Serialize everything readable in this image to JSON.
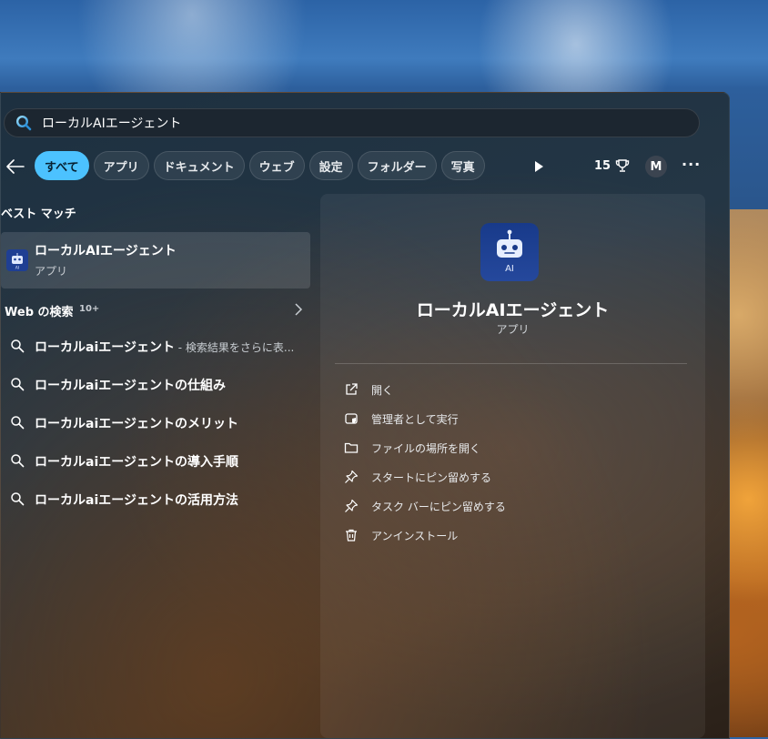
{
  "search": {
    "query": "ローカルAIエージェント"
  },
  "filters": [
    "すべて",
    "アプリ",
    "ドキュメント",
    "ウェブ",
    "設定",
    "フォルダー",
    "写真"
  ],
  "toolbar": {
    "points": "15",
    "avatar": "M",
    "more": "···"
  },
  "best_match": {
    "heading": "ベスト マッチ",
    "name": "ローカルAIエージェント",
    "type": "アプリ"
  },
  "web": {
    "heading": "Web の検索",
    "count": "10+",
    "suggestions": [
      {
        "text": "ローカルaiエージェント",
        "sub": " - 検索結果をさらに表..."
      },
      {
        "text": "ローカルaiエージェントの仕組み",
        "sub": ""
      },
      {
        "text": "ローカルaiエージェントのメリット",
        "sub": ""
      },
      {
        "text": "ローカルaiエージェントの導入手順",
        "sub": ""
      },
      {
        "text": "ローカルaiエージェントの活用方法",
        "sub": ""
      }
    ]
  },
  "detail": {
    "icon_label": "AI",
    "title": "ローカルAIエージェント",
    "type": "アプリ",
    "actions": [
      {
        "label": "開く",
        "icon": "open-external-icon"
      },
      {
        "label": "管理者として実行",
        "icon": "shield-admin-icon"
      },
      {
        "label": "ファイルの場所を開く",
        "icon": "folder-icon"
      },
      {
        "label": "スタートにピン留めする",
        "icon": "pin-icon"
      },
      {
        "label": "タスク バーにピン留めする",
        "icon": "pin-icon"
      },
      {
        "label": "アンインストール",
        "icon": "trash-icon"
      }
    ]
  },
  "colors": {
    "accent": "#4cc2ff",
    "app_icon_bg": "#1f3f93"
  }
}
